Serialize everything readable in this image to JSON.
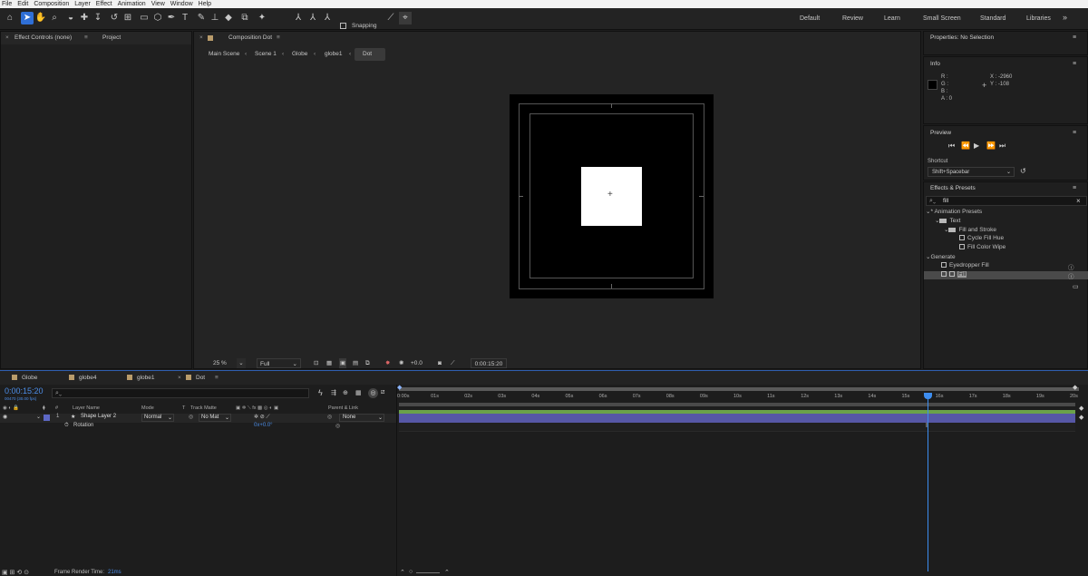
{
  "menu": [
    "File",
    "Edit",
    "Composition",
    "Layer",
    "Effect",
    "Animation",
    "View",
    "Window",
    "Help"
  ],
  "toolbar": {
    "snapping": "Snapping",
    "workspaces": [
      "Default",
      "Review",
      "Learn",
      "Small Screen",
      "Standard",
      "Libraries"
    ]
  },
  "left_panel": {
    "tabs": [
      "Effect Controls (none)",
      "Project"
    ]
  },
  "comp_panel": {
    "title": "Composition Dot",
    "breadcrumbs": [
      "Main Scene",
      "Scene 1",
      "Globe",
      "globe1",
      "Dot"
    ],
    "zoom": "25 %",
    "resolution": "Full",
    "exposure": "+0.0",
    "timecode": "0:00:15:20"
  },
  "properties": {
    "title": "Properties: No Selection"
  },
  "info": {
    "title": "Info",
    "r": "R :",
    "g": "G :",
    "b": "B :",
    "a": "A :  0",
    "x": "X : -2960",
    "y": "Y : -108"
  },
  "preview": {
    "title": "Preview",
    "shortcut_label": "Shortcut",
    "shortcut_value": "Shift+Spacebar"
  },
  "effects": {
    "title": "Effects & Presets",
    "search": "fill",
    "items": [
      "Animation Presets",
      "Text",
      "Fill and Stroke",
      "Cycle Fill Hue",
      "Fill Color Wipe",
      "Generate",
      "Eyedropper Fill",
      "Fill"
    ]
  },
  "timeline": {
    "tabs": [
      "Globe",
      "globe4",
      "globe1",
      "Dot"
    ],
    "current_time": "0:00:15:20",
    "frames": "00470 (30.00 fps)",
    "ruler": [
      "0:00s",
      "01s",
      "02s",
      "03s",
      "04s",
      "05s",
      "06s",
      "07s",
      "08s",
      "09s",
      "10s",
      "11s",
      "12s",
      "13s",
      "14s",
      "15s",
      "16s",
      "17s",
      "18s",
      "19s",
      "20s"
    ],
    "columns": {
      "num": "#",
      "layer_name": "Layer Name",
      "mode": "Mode",
      "t": "T",
      "track_matte": "Track Matte",
      "parent": "Parent & Link"
    },
    "layer": {
      "index": "1",
      "name": "Shape Layer 2",
      "mode": "Normal",
      "matte": "No Mat",
      "parent": "None"
    },
    "property": {
      "name": "Rotation",
      "value": "0x+0.0°"
    },
    "render_label": "Frame Render Time:",
    "render_value": "21ms"
  },
  "colors": {
    "accent": "#2f6fd6",
    "layer_bar": "#5657a6",
    "work_area": "#6aa24a",
    "playhead": "#3d8df0"
  }
}
